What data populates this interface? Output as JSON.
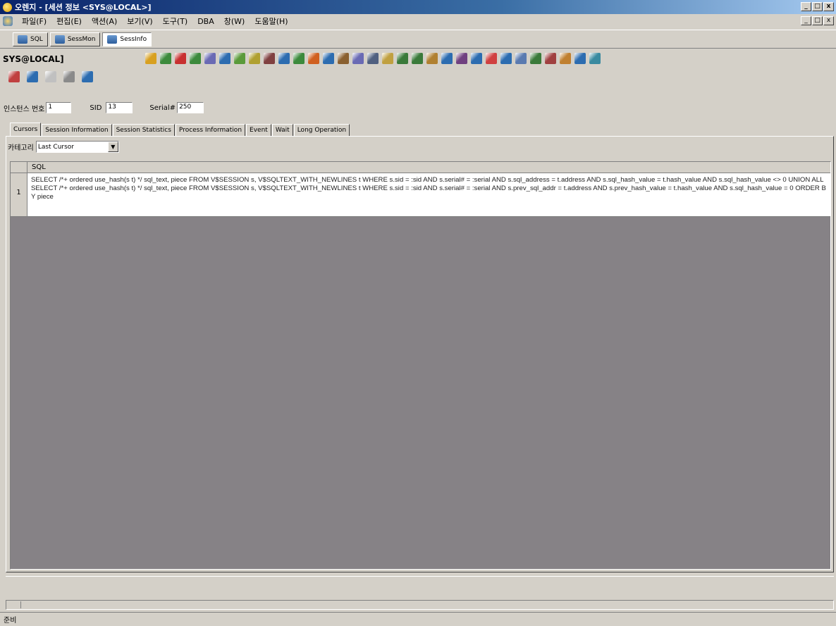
{
  "window": {
    "title": "오렌지 - [세션 정보 <SYS@LOCAL>]",
    "min": "_",
    "max": "□",
    "close": "x"
  },
  "menu": {
    "items": [
      "파일(F)",
      "편집(E)",
      "액션(A)",
      "보기(V)",
      "도구(T)",
      "DBA",
      "창(W)",
      "도움말(H)"
    ]
  },
  "doc_tabs": [
    {
      "label": "SQL"
    },
    {
      "label": "SessMon"
    },
    {
      "label": "SessInfo"
    }
  ],
  "connection": "SYS@LOCAL]",
  "toolbar_colors": [
    "#d8a020",
    "#3c8a3c",
    "#c83030",
    "#3c8a3c",
    "#6a6ab4",
    "#2c6cb0",
    "#5a9a3a",
    "#b0a030",
    "#804040",
    "#2c6cb0",
    "#3c8a3c",
    "#d06020",
    "#2c6cb0",
    "#8a6030",
    "#6a6ab4",
    "#506080",
    "#c0a040",
    "#3a7a3a",
    "#3a7a3a",
    "#b08030",
    "#2c6cb0",
    "#704080",
    "#2c6cb0",
    "#d04040",
    "#2c6cb0",
    "#5a7ab0",
    "#3a7a3a",
    "#a04040",
    "#c08030",
    "#2c6cb0",
    "#3a8aa0"
  ],
  "toolbar2_colors": [
    "#c04040",
    "#2c6cb0",
    "#c0c0c0",
    "#8a8a8a",
    "#2c6cb0"
  ],
  "params": {
    "instance_label": "인스턴스 번호",
    "instance_value": "1",
    "sid_label": "SID",
    "sid_value": "13",
    "serial_label": "Serial#",
    "serial_value": "250"
  },
  "sub_tabs": [
    "Cursors",
    "Session Information",
    "Session Statistics",
    "Process Information",
    "Event",
    "Wait",
    "Long Operation"
  ],
  "category": {
    "label": "카테고리",
    "value": "Last Cursor",
    "arrow": "▼"
  },
  "grid": {
    "column": "SQL",
    "rows": [
      {
        "num": "1",
        "sql": "SELECT /*+ ordered use_hash(s t) */  sql_text, piece FROM V$SESSION s, V$SQLTEXT_WITH_NEWLINES t WHERE s.sid = :sid AND s.serial# = :serial AND s.sql_address = t.address AND s.sql_hash_value = t.hash_value AND s.sql_hash_value <> 0 UNION ALL SELECT /*+ ordered use_hash(s t) */  sql_text, piece FROM V$SESSION s, V$SQLTEXT_WITH_NEWLINES t WHERE s.sid = :sid AND s.serial# = :serial AND s.prev_sql_addr = t.address AND s.prev_hash_value = t.hash_value AND s.sql_hash_value = 0 ORDER BY piece"
      }
    ]
  },
  "status": "준비"
}
